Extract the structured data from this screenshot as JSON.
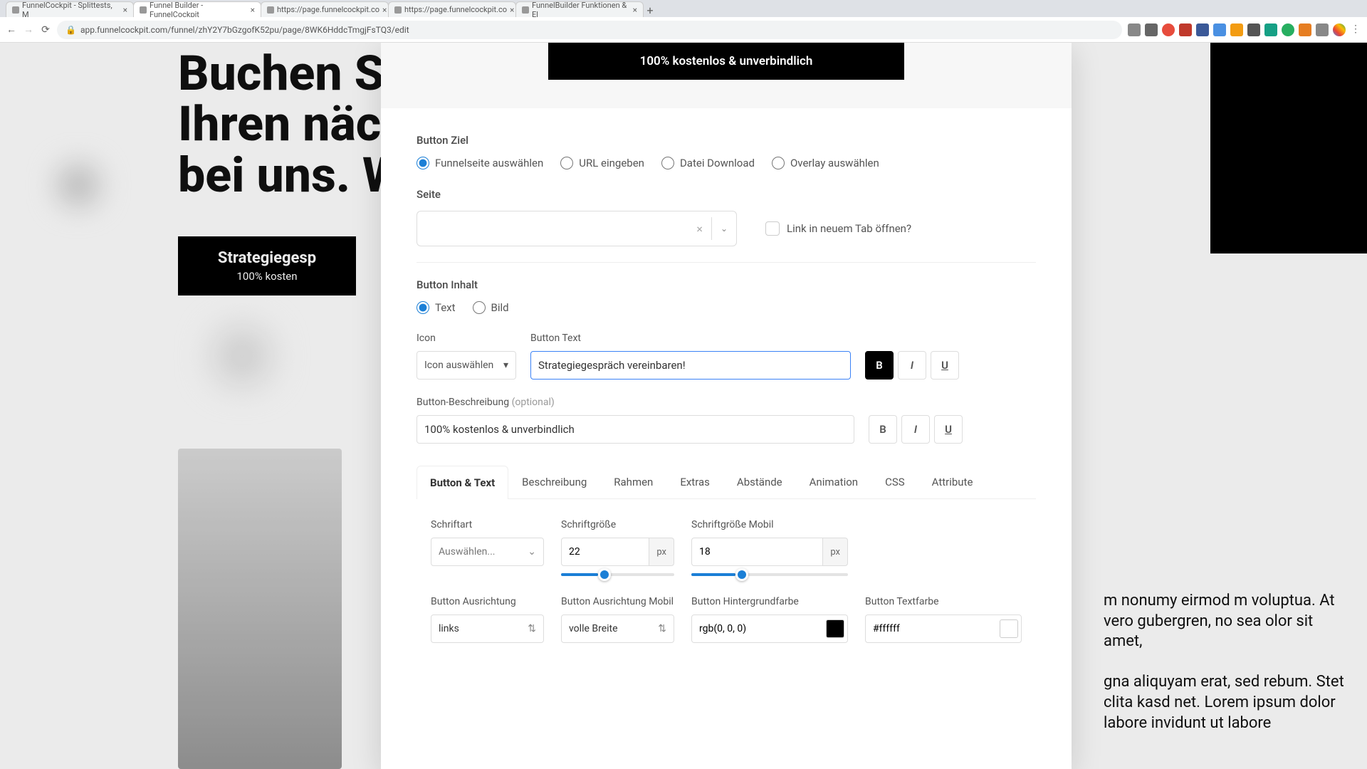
{
  "browser": {
    "tabs": [
      {
        "title": "FunnelCockpit - Splittests, M",
        "active": false
      },
      {
        "title": "Funnel Builder - FunnelCockpit",
        "active": true
      },
      {
        "title": "https://page.funnelcockpit.co",
        "active": false
      },
      {
        "title": "https://page.funnelcockpit.co",
        "active": false
      },
      {
        "title": "FunnelBuilder Funktionen & El",
        "active": false
      }
    ],
    "url": "app.funnelcockpit.com/funnel/zhY2Y7bGzgofK52pu/page/8WK6HddcTmgjFsTQ3/edit",
    "extensions": 13
  },
  "background": {
    "heading_line1": "Buchen Si",
    "heading_line2": "Ihren näch",
    "heading_line3": "bei uns. W",
    "button_line1": "Strategiegesp",
    "button_line2": "100% kosten",
    "text_block": "m nonumy eirmod m voluptua. At vero gubergren, no sea olor sit amet,\n\ngna aliquyam erat, sed rebum. Stet clita kasd net. Lorem ipsum dolor labore invidunt ut labore"
  },
  "preview": {
    "button_subtext": "100% kostenlos & unverbindlich"
  },
  "form": {
    "button_ziel": {
      "label": "Button Ziel",
      "options": [
        "Funnelseite auswählen",
        "URL eingeben",
        "Datei Download",
        "Overlay auswählen"
      ],
      "selected": 0
    },
    "seite": {
      "label": "Seite",
      "checkbox_label": "Link in neuem Tab öffnen?"
    },
    "button_inhalt": {
      "label": "Button Inhalt",
      "options": [
        "Text",
        "Bild"
      ],
      "selected": 0
    },
    "icon": {
      "label": "Icon",
      "placeholder": "Icon auswählen"
    },
    "button_text": {
      "label": "Button Text",
      "value": "Strategiegespräch vereinbaren!"
    },
    "button_desc": {
      "label": "Button-Beschreibung",
      "optional": "(optional)",
      "value": "100% kostenlos & unverbindlich"
    },
    "format": {
      "bold": "B",
      "italic": "I",
      "underline": "U"
    },
    "tabs": [
      "Button & Text",
      "Beschreibung",
      "Rahmen",
      "Extras",
      "Abstände",
      "Animation",
      "CSS",
      "Attribute"
    ],
    "tab_content": {
      "schriftart": {
        "label": "Schriftart",
        "placeholder": "Auswählen..."
      },
      "schriftgroesse": {
        "label": "Schriftgröße",
        "value": "22",
        "unit": "px",
        "slider_pct": 33
      },
      "schriftgroesse_mobil": {
        "label": "Schriftgröße Mobil",
        "value": "18",
        "unit": "px",
        "slider_pct": 28
      },
      "button_ausrichtung": {
        "label": "Button Ausrichtung",
        "value": "links"
      },
      "button_ausrichtung_mobil": {
        "label": "Button Ausrichtung Mobil",
        "value": "volle Breite"
      },
      "button_bg": {
        "label": "Button Hintergrundfarbe",
        "value": "rgb(0, 0, 0)",
        "swatch": "#000000"
      },
      "button_textcolor": {
        "label": "Button Textfarbe",
        "value": "#ffffff",
        "swatch": "#ffffff"
      }
    }
  }
}
